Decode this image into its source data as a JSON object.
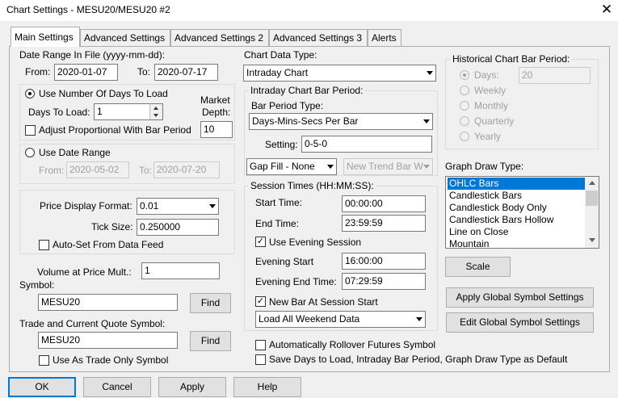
{
  "window": {
    "title": "Chart Settings - MESU20/MESU20  #2",
    "close": "✕"
  },
  "tabs": [
    "Main Settings",
    "Advanced Settings",
    "Advanced Settings 2",
    "Advanced Settings 3",
    "Alerts"
  ],
  "date_range_file": {
    "label": "Date Range In File (yyyy-mm-dd):",
    "from_label": "From:",
    "from": "2020-01-07",
    "to_label": "To:",
    "to": "2020-07-17"
  },
  "days_group": {
    "radio_label": "Use Number Of Days To Load",
    "days_label": "Days To Load:",
    "days_value": "1",
    "market_depth_label1": "Market",
    "market_depth_label2": "Depth:",
    "market_depth_value": "10",
    "adjust_label": "Adjust Proportional With Bar Period"
  },
  "date_range_group": {
    "radio_label": "Use Date Range",
    "from_label": "From:",
    "from": "2020-05-02",
    "to_label": "To:",
    "to": "2020-07-20"
  },
  "price_group": {
    "price_format_label": "Price Display Format:",
    "price_format_value": "0.01",
    "tick_size_label": "Tick Size:",
    "tick_size_value": "0.250000",
    "auto_set_label": "Auto-Set From Data Feed"
  },
  "volume": {
    "label": "Volume at Price Mult.:",
    "value": "1"
  },
  "symbol": {
    "label": "Symbol:",
    "value": "MESU20",
    "find": "Find"
  },
  "trade_symbol": {
    "label": "Trade and Current Quote Symbol:",
    "value": "MESU20",
    "find": "Find",
    "trade_only_label": "Use As Trade Only Symbol"
  },
  "chart_data_type": {
    "label": "Chart Data Type:",
    "value": "Intraday Chart"
  },
  "intraday_group": {
    "title": "Intraday Chart Bar Period:",
    "bar_period_type_label": "Bar Period Type:",
    "bar_period_type_value": "Days-Mins-Secs Per Bar",
    "setting_label": "Setting:",
    "setting_value": "0-5-0",
    "gap_fill_value": "Gap Fill - None",
    "new_trend_value": "New Trend Bar W"
  },
  "session_group": {
    "title": "Session Times (HH:MM:SS):",
    "start_label": "Start Time:",
    "start_value": "00:00:00",
    "end_label": "End Time:",
    "end_value": "23:59:59",
    "evening_session_label": "Use Evening Session",
    "evening_start_label": "Evening Start",
    "evening_start_value": "16:00:00",
    "evening_end_label": "Evening End Time:",
    "evening_end_value": "07:29:59",
    "new_bar_label": "New Bar At Session Start",
    "weekend_value": "Load All Weekend Data"
  },
  "rollover_label": "Automatically Rollover Futures Symbol",
  "save_default_label": "Save Days to Load, Intraday Bar Period, Graph Draw Type as Default",
  "historical_group": {
    "title": "Historical Chart Bar Period:",
    "options": [
      "Days:",
      "Weekly",
      "Monthly",
      "Quarterly",
      "Yearly"
    ],
    "days_value": "20"
  },
  "graph_draw": {
    "label": "Graph Draw Type:",
    "items": [
      "OHLC Bars",
      "Candlestick Bars",
      "Candlestick Body Only",
      "Candlestick Bars Hollow",
      "Line on Close",
      "Mountain"
    ]
  },
  "buttons": {
    "scale": "Scale",
    "apply_global": "Apply Global Symbol Settings",
    "edit_global": "Edit Global Symbol Settings",
    "ok": "OK",
    "cancel": "Cancel",
    "apply": "Apply",
    "help": "Help"
  }
}
